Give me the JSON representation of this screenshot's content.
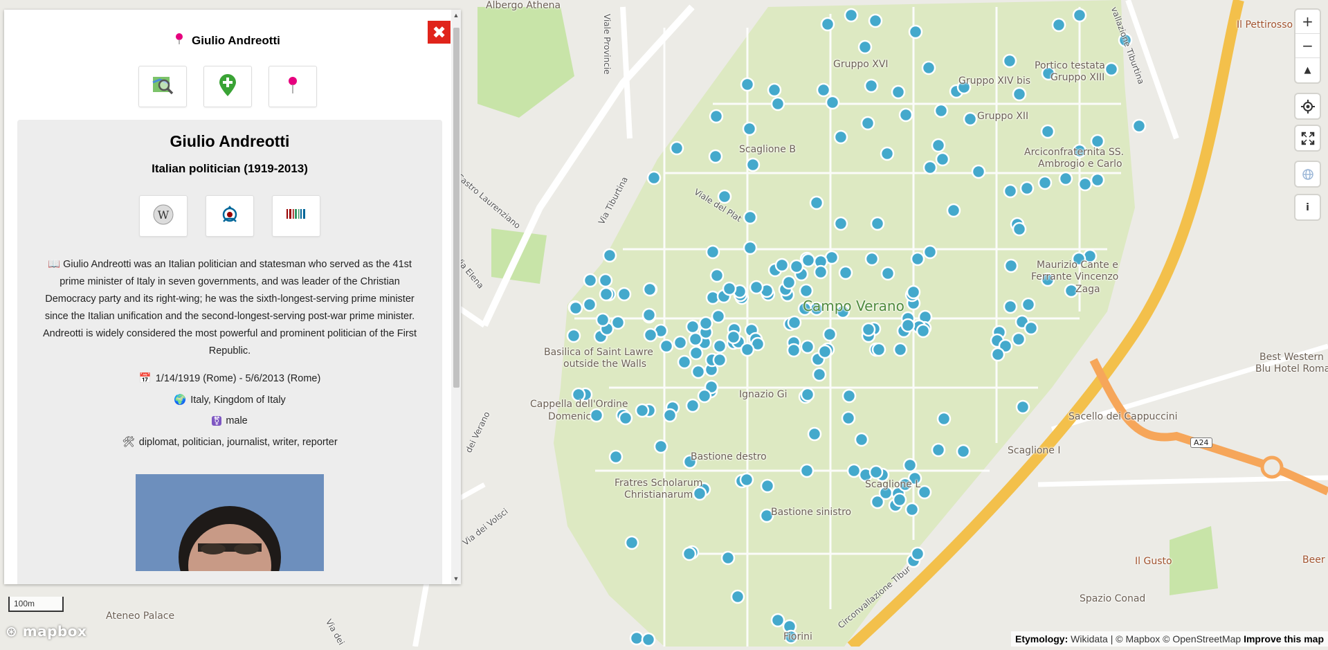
{
  "map": {
    "colors": {
      "cemetery": "#dde9c2",
      "background": "#ecebe6",
      "motorway": "#f3c04b",
      "marker": "#44a9cc",
      "park": "#c8e4a8"
    },
    "labels": {
      "albergo_athena": "Albergo Athena",
      "viale_provincie": "Viale Provincie",
      "gruppo_xvi": "Gruppo XVI",
      "portico_testata": "Portico testata",
      "gruppo_xiii": "Gruppo XIII",
      "gruppo_xiv_bis": "Gruppo XIV bis",
      "gruppo_xii": "Gruppo XII",
      "scaglione_b": "Scaglione B",
      "arciconfraternita": "Arciconfraternita SS.",
      "ambrogio_carlo": "Ambrogio e Carlo",
      "campo_verano": "Campo Verano",
      "maurizio": "Maurizio Cante e",
      "ferrante": "Ferrante Vincenzo",
      "zaga": "Zaga",
      "basilica_1": "Basilica of Saint Lawre",
      "basilica_2": "outside the Walls",
      "cappella_1": "Cappella dell'Ordine",
      "cappella_2": "Domenic",
      "ignazio": "Ignazio Gi",
      "sacello": "Sacello dei Cappuccini",
      "scaglione_i": "Scaglione I",
      "bastione_destro": "Bastione destro",
      "fratres_1": "Fratres Scholarum",
      "fratres_2": "Christianarum",
      "bastione_sinistro": "Bastione sinistro",
      "scaglione_l": "Scaglione L",
      "fiorini": "Fiorini",
      "ateneo": "Ateneo Palace",
      "il_pettirosso": "Il Pettirosso",
      "best_western_1": "Best Western",
      "best_western_2": "Blu Hotel Roma",
      "il_gusto": "Il Gusto",
      "spazio_conad": "Spazio Conad",
      "beer": "Beer",
      "via_tiburtina": "Via Tiburtina",
      "castro_laurenziano": "Castro Laurenziano",
      "via_elena": "Via Elena",
      "viale_plat": "Viale del Plat",
      "via_volsci": "Via dei Volsci",
      "circonvallazione_1": "Circonvallazione Tibur",
      "circonvallazione_2": "vallazione Tiburtina",
      "del_verano": "dei Verano",
      "via_dei": "Via dei",
      "a24": "A24"
    },
    "controls": {
      "zoom_in": "+",
      "zoom_out": "−",
      "compass": "▲",
      "locate_icon": "locate-icon",
      "fullscreen_icon": "fullscreen-icon",
      "globe_icon": "globe-icon",
      "info": "i"
    },
    "scale_label": "100m",
    "logo_text": "mapbox",
    "attribution": {
      "etymology": "Etymology:",
      "wikidata": "Wikidata",
      "sep": " | © Mapbox © OpenStreetMap ",
      "improve": "Improve this map"
    }
  },
  "popup": {
    "close_label": "✖",
    "title": "Giulio Andreotti",
    "actions": {
      "explore_icon": "map-search-icon",
      "add_icon": "add-location-icon",
      "pin_icon": "pin-icon"
    },
    "card": {
      "name": "Giulio Andreotti",
      "subtitle": "Italian politician (1919-2013)",
      "links": {
        "wikipedia_icon": "wikipedia-icon",
        "commons_icon": "wikimedia-commons-icon",
        "wikidata_icon": "wikidata-icon"
      },
      "description": "📖 Giulio Andreotti was an Italian politician and statesman who served as the 41st prime minister of Italy in seven governments, and was leader of the Christian Democracy party and its right-wing; he was the sixth-longest-serving prime minister since the Italian unification and the second-longest-serving post-war prime minister. Andreotti is widely considered the most powerful and prominent politician of the First Republic.",
      "dates_icon": "📅",
      "dates": "1/14/1919 (Rome) - 5/6/2013 (Rome)",
      "country_icon": "🌍",
      "country": "Italy, Kingdom of Italy",
      "gender_icon": "⚧",
      "gender": "male",
      "occupation_icon": "🛠",
      "occupation": "diplomat, politician, journalist, writer, reporter"
    }
  }
}
